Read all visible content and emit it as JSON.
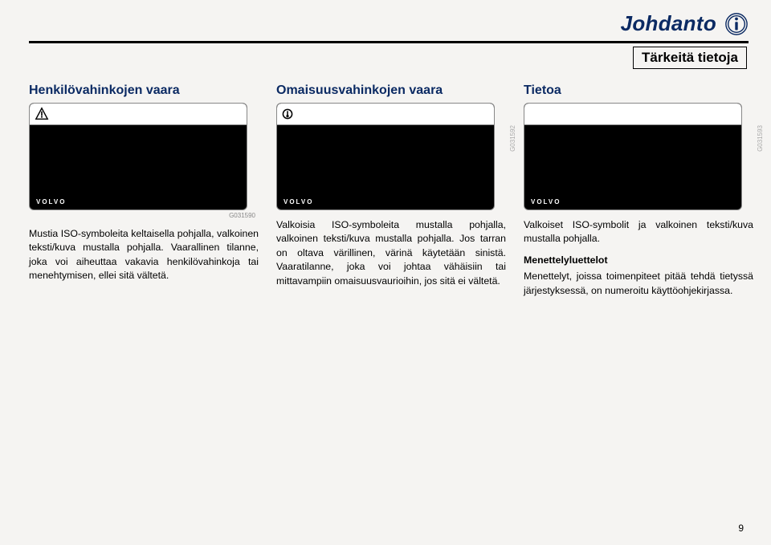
{
  "header": {
    "title": "Johdanto",
    "sub_title": "Tärkeitä tietoja"
  },
  "page_number": "9",
  "columns": {
    "col1": {
      "heading": "Henkilövahinkojen vaara",
      "panel_logo": "VOLVO",
      "panel_label": "G031590",
      "body": "Mustia ISO-symboleita keltaisella pohjalla, valkoinen teksti/kuva mustalla pohjalla. Vaarallinen tilanne, joka voi aiheuttaa vakavia henkilövahinkoja tai menehtymisen, ellei sitä vältetä."
    },
    "col2": {
      "heading": "Omaisuusvahinkojen vaara",
      "panel_logo": "VOLVO",
      "panel_label": "G031592",
      "body": "Valkoisia ISO-symboleita mustalla pohjalla, valkoinen teksti/kuva mustalla pohjalla. Jos tarran on oltava värillinen, värinä käytetään sinistä. Vaaratilanne, joka voi johtaa vähäisiin tai mittavampiin omaisuusvaurioihin, jos sitä ei vältetä."
    },
    "col3": {
      "heading": "Tietoa",
      "panel_logo": "VOLVO",
      "panel_label": "G031593",
      "body1": "Valkoiset ISO-symbolit ja valkoinen teksti/kuva mustalla pohjalla.",
      "body2_head": "Menettelyluettelot",
      "body2": "Menettelyt, joissa toimenpiteet pitää tehdä tietyssä järjestyksessä, on numeroitu käyttöohjekirjassa."
    }
  }
}
